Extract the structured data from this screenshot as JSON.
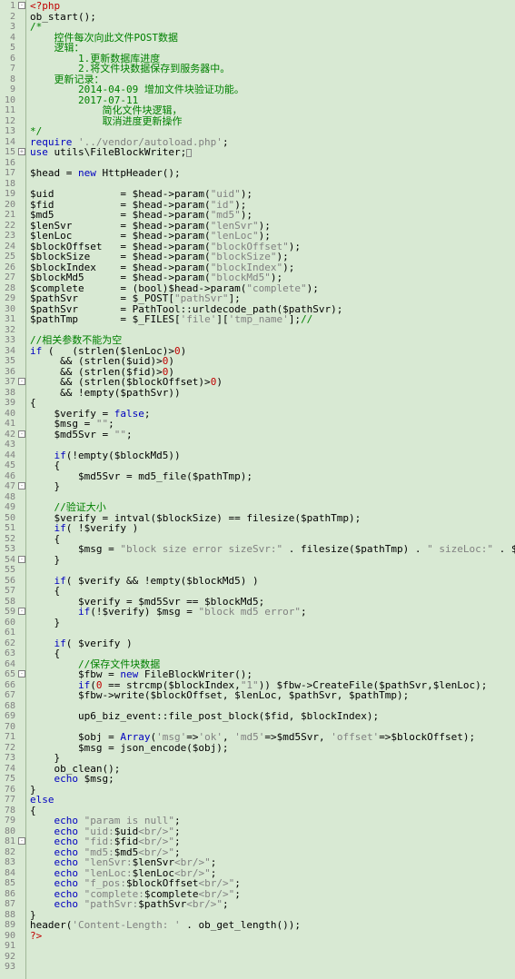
{
  "lineCount": 93,
  "foldMarks": [
    {
      "line": 1,
      "sym": "-"
    },
    {
      "line": 15,
      "sym": "+"
    },
    {
      "line": 37,
      "sym": "-"
    },
    {
      "line": 42,
      "sym": "-"
    },
    {
      "line": 47,
      "sym": "-"
    },
    {
      "line": 54,
      "sym": "-"
    },
    {
      "line": 59,
      "sym": "-"
    },
    {
      "line": 65,
      "sym": "-"
    },
    {
      "line": 81,
      "sym": "-"
    }
  ],
  "code": [
    [
      [
        "red",
        "<?php"
      ]
    ],
    [
      [
        "blk",
        "ob_start();"
      ]
    ],
    [
      [
        "green",
        "/*"
      ]
    ],
    [
      [
        "green",
        "    控件每次向此文件POST数据"
      ]
    ],
    [
      [
        "green",
        "    逻辑："
      ]
    ],
    [
      [
        "green",
        "        1.更新数据库进度"
      ]
    ],
    [
      [
        "green",
        "        2.将文件块数据保存到服务器中。"
      ]
    ],
    [
      [
        "green",
        "    更新记录："
      ]
    ],
    [
      [
        "green",
        "        2014-04-09 增加文件块验证功能。"
      ]
    ],
    [
      [
        "green",
        "        2017-07-11"
      ]
    ],
    [
      [
        "green",
        "            简化文件块逻辑，"
      ]
    ],
    [
      [
        "green",
        "            取消进度更新操作"
      ]
    ],
    [
      [
        "green",
        "*/"
      ]
    ],
    [
      [
        "blue",
        "require "
      ],
      [
        "str",
        "'../vendor/autoload.php'"
      ],
      [
        "blk",
        ";"
      ]
    ],
    [
      [
        "blue",
        "use "
      ],
      [
        "blk",
        "utils\\FileBlockWriter;"
      ],
      [
        "caret",
        ""
      ]
    ],
    [
      [
        "blk",
        ""
      ]
    ],
    [
      [
        "blk",
        "$head = "
      ],
      [
        "blue",
        "new "
      ],
      [
        "blk",
        "HttpHeader();"
      ]
    ],
    [
      [
        "blk",
        ""
      ]
    ],
    [
      [
        "blk",
        "$uid           = $head->param("
      ],
      [
        "str",
        "\"uid\""
      ],
      [
        "blk",
        ");"
      ]
    ],
    [
      [
        "blk",
        "$fid           = $head->param("
      ],
      [
        "str",
        "\"id\""
      ],
      [
        "blk",
        ");"
      ]
    ],
    [
      [
        "blk",
        "$md5           = $head->param("
      ],
      [
        "str",
        "\"md5\""
      ],
      [
        "blk",
        ");"
      ]
    ],
    [
      [
        "blk",
        "$lenSvr        = $head->param("
      ],
      [
        "str",
        "\"lenSvr\""
      ],
      [
        "blk",
        ");"
      ]
    ],
    [
      [
        "blk",
        "$lenLoc        = $head->param("
      ],
      [
        "str",
        "\"lenLoc\""
      ],
      [
        "blk",
        ");"
      ]
    ],
    [
      [
        "blk",
        "$blockOffset   = $head->param("
      ],
      [
        "str",
        "\"blockOffset\""
      ],
      [
        "blk",
        ");"
      ]
    ],
    [
      [
        "blk",
        "$blockSize     = $head->param("
      ],
      [
        "str",
        "\"blockSize\""
      ],
      [
        "blk",
        ");"
      ]
    ],
    [
      [
        "blk",
        "$blockIndex    = $head->param("
      ],
      [
        "str",
        "\"blockIndex\""
      ],
      [
        "blk",
        ");"
      ]
    ],
    [
      [
        "blk",
        "$blockMd5      = $head->param("
      ],
      [
        "str",
        "\"blockMd5\""
      ],
      [
        "blk",
        ");"
      ]
    ],
    [
      [
        "blk",
        "$complete      = (bool)$head->param("
      ],
      [
        "str",
        "\"complete\""
      ],
      [
        "blk",
        ");"
      ]
    ],
    [
      [
        "blk",
        "$pathSvr       = $_POST["
      ],
      [
        "str",
        "\"pathSvr\""
      ],
      [
        "blk",
        "];"
      ]
    ],
    [
      [
        "blk",
        "$pathSvr       = PathTool::urldecode_path($pathSvr);"
      ]
    ],
    [
      [
        "blk",
        "$pathTmp       = $_FILES["
      ],
      [
        "str",
        "'file'"
      ],
      [
        "blk",
        "]["
      ],
      [
        "str",
        "'tmp_name'"
      ],
      [
        "blk",
        "];"
      ],
      [
        "green",
        "//"
      ]
    ],
    [
      [
        "blk",
        ""
      ]
    ],
    [
      [
        "green",
        "//相关参数不能为空"
      ]
    ],
    [
      [
        "blue",
        "if "
      ],
      [
        "blk",
        "(   (strlen($lenLoc)>"
      ],
      [
        "red",
        "0"
      ],
      [
        "blk",
        ")"
      ]
    ],
    [
      [
        "blk",
        "     && (strlen($uid)>"
      ],
      [
        "red",
        "0"
      ],
      [
        "blk",
        ")"
      ]
    ],
    [
      [
        "blk",
        "     && (strlen($fid)>"
      ],
      [
        "red",
        "0"
      ],
      [
        "blk",
        ")"
      ]
    ],
    [
      [
        "blk",
        "     && (strlen($blockOffset)>"
      ],
      [
        "red",
        "0"
      ],
      [
        "blk",
        ")"
      ]
    ],
    [
      [
        "blk",
        "     && !empty($pathSvr))"
      ]
    ],
    [
      [
        "blk",
        "{"
      ]
    ],
    [
      [
        "blk",
        "    $verify = "
      ],
      [
        "blue",
        "false"
      ],
      [
        "blk",
        ";"
      ]
    ],
    [
      [
        "blk",
        "    $msg = "
      ],
      [
        "str",
        "\"\""
      ],
      [
        "blk",
        ";"
      ]
    ],
    [
      [
        "blk",
        "    $md5Svr = "
      ],
      [
        "str",
        "\"\""
      ],
      [
        "blk",
        ";"
      ]
    ],
    [
      [
        "blk",
        ""
      ]
    ],
    [
      [
        "blk",
        "    "
      ],
      [
        "blue",
        "if"
      ],
      [
        "blk",
        "(!empty($blockMd5))"
      ]
    ],
    [
      [
        "blk",
        "    {"
      ]
    ],
    [
      [
        "blk",
        "        $md5Svr = md5_file($pathTmp);"
      ]
    ],
    [
      [
        "blk",
        "    }"
      ]
    ],
    [
      [
        "blk",
        ""
      ]
    ],
    [
      [
        "blk",
        "    "
      ],
      [
        "green",
        "//验证大小"
      ]
    ],
    [
      [
        "blk",
        "    $verify = intval($blockSize) == filesize($pathTmp);"
      ]
    ],
    [
      [
        "blk",
        "    "
      ],
      [
        "blue",
        "if"
      ],
      [
        "blk",
        "( !$verify )"
      ]
    ],
    [
      [
        "blk",
        "    {"
      ]
    ],
    [
      [
        "blk",
        "        $msg = "
      ],
      [
        "str",
        "\"block size error sizeSvr:\""
      ],
      [
        "blk",
        " . filesize($pathTmp) . "
      ],
      [
        "str",
        "\" sizeLoc:\""
      ],
      [
        "blk",
        " . $blockSize;"
      ]
    ],
    [
      [
        "blk",
        "    }"
      ]
    ],
    [
      [
        "blk",
        ""
      ]
    ],
    [
      [
        "blk",
        "    "
      ],
      [
        "blue",
        "if"
      ],
      [
        "blk",
        "( $verify && !empty($blockMd5) )"
      ]
    ],
    [
      [
        "blk",
        "    {"
      ]
    ],
    [
      [
        "blk",
        "        $verify = $md5Svr == $blockMd5;"
      ]
    ],
    [
      [
        "blk",
        "        "
      ],
      [
        "blue",
        "if"
      ],
      [
        "blk",
        "(!$verify) $msg = "
      ],
      [
        "str",
        "\"block md5 error\""
      ],
      [
        "blk",
        ";"
      ]
    ],
    [
      [
        "blk",
        "    }"
      ]
    ],
    [
      [
        "blk",
        ""
      ]
    ],
    [
      [
        "blk",
        "    "
      ],
      [
        "blue",
        "if"
      ],
      [
        "blk",
        "( $verify )"
      ]
    ],
    [
      [
        "blk",
        "    {"
      ]
    ],
    [
      [
        "blk",
        "        "
      ],
      [
        "green",
        "//保存文件块数据"
      ]
    ],
    [
      [
        "blk",
        "        $fbw = "
      ],
      [
        "blue",
        "new "
      ],
      [
        "blk",
        "FileBlockWriter();"
      ]
    ],
    [
      [
        "blk",
        "        "
      ],
      [
        "blue",
        "if"
      ],
      [
        "blk",
        "("
      ],
      [
        "red",
        "0"
      ],
      [
        "blk",
        " == strcmp($blockIndex,"
      ],
      [
        "str",
        "\"1\""
      ],
      [
        "blk",
        ")) $fbw->CreateFile($pathSvr,$lenLoc);"
      ]
    ],
    [
      [
        "blk",
        "        $fbw->write($blockOffset, $lenLoc, $pathSvr, $pathTmp);"
      ]
    ],
    [
      [
        "blk",
        ""
      ]
    ],
    [
      [
        "blk",
        "        up6_biz_event::file_post_block($fid, $blockIndex);"
      ]
    ],
    [
      [
        "blk",
        ""
      ]
    ],
    [
      [
        "blk",
        "        $obj = "
      ],
      [
        "blue",
        "Array"
      ],
      [
        "blk",
        "("
      ],
      [
        "str",
        "'msg'"
      ],
      [
        "blk",
        "=>"
      ],
      [
        "str",
        "'ok'"
      ],
      [
        "blk",
        ", "
      ],
      [
        "str",
        "'md5'"
      ],
      [
        "blk",
        "=>$md5Svr, "
      ],
      [
        "str",
        "'offset'"
      ],
      [
        "blk",
        "=>$blockOffset);"
      ]
    ],
    [
      [
        "blk",
        "        $msg = json_encode($obj);"
      ]
    ],
    [
      [
        "blk",
        "    }"
      ]
    ],
    [
      [
        "blk",
        "    ob_clean();"
      ]
    ],
    [
      [
        "blk",
        "    "
      ],
      [
        "blue",
        "echo "
      ],
      [
        "blk",
        "$msg;"
      ]
    ],
    [
      [
        "blk",
        "}"
      ]
    ],
    [
      [
        "blue",
        "else"
      ]
    ],
    [
      [
        "blk",
        "{"
      ]
    ],
    [
      [
        "blk",
        "    "
      ],
      [
        "blue",
        "echo "
      ],
      [
        "str",
        "\"param is null\""
      ],
      [
        "blk",
        ";"
      ]
    ],
    [
      [
        "blk",
        "    "
      ],
      [
        "blue",
        "echo "
      ],
      [
        "str",
        "\"uid:"
      ],
      [
        "blk",
        "$uid"
      ],
      [
        "str",
        "<br/>\""
      ],
      [
        "blk",
        ";"
      ]
    ],
    [
      [
        "blk",
        "    "
      ],
      [
        "blue",
        "echo "
      ],
      [
        "str",
        "\"fid:"
      ],
      [
        "blk",
        "$fid"
      ],
      [
        "str",
        "<br/>\""
      ],
      [
        "blk",
        ";"
      ]
    ],
    [
      [
        "blk",
        "    "
      ],
      [
        "blue",
        "echo "
      ],
      [
        "str",
        "\"md5:"
      ],
      [
        "blk",
        "$md5"
      ],
      [
        "str",
        "<br/>\""
      ],
      [
        "blk",
        ";"
      ]
    ],
    [
      [
        "blk",
        "    "
      ],
      [
        "blue",
        "echo "
      ],
      [
        "str",
        "\"lenSvr:"
      ],
      [
        "blk",
        "$lenSvr"
      ],
      [
        "str",
        "<br/>\""
      ],
      [
        "blk",
        ";"
      ]
    ],
    [
      [
        "blk",
        "    "
      ],
      [
        "blue",
        "echo "
      ],
      [
        "str",
        "\"lenLoc:"
      ],
      [
        "blk",
        "$lenLoc"
      ],
      [
        "str",
        "<br/>\""
      ],
      [
        "blk",
        ";"
      ]
    ],
    [
      [
        "blk",
        "    "
      ],
      [
        "blue",
        "echo "
      ],
      [
        "str",
        "\"f_pos:"
      ],
      [
        "blk",
        "$blockOffset"
      ],
      [
        "str",
        "<br/>\""
      ],
      [
        "blk",
        ";"
      ]
    ],
    [
      [
        "blk",
        "    "
      ],
      [
        "blue",
        "echo "
      ],
      [
        "str",
        "\"complete:"
      ],
      [
        "blk",
        "$complete"
      ],
      [
        "str",
        "<br/>\""
      ],
      [
        "blk",
        ";"
      ]
    ],
    [
      [
        "blk",
        "    "
      ],
      [
        "blue",
        "echo "
      ],
      [
        "str",
        "\"pathSvr:"
      ],
      [
        "blk",
        "$pathSvr"
      ],
      [
        "str",
        "<br/>\""
      ],
      [
        "blk",
        ";"
      ]
    ],
    [
      [
        "blk",
        "}"
      ]
    ],
    [
      [
        "blk",
        "header("
      ],
      [
        "str",
        "'Content-Length: '"
      ],
      [
        "blk",
        " . ob_get_length());"
      ]
    ],
    [
      [
        "red",
        "?>"
      ]
    ]
  ]
}
